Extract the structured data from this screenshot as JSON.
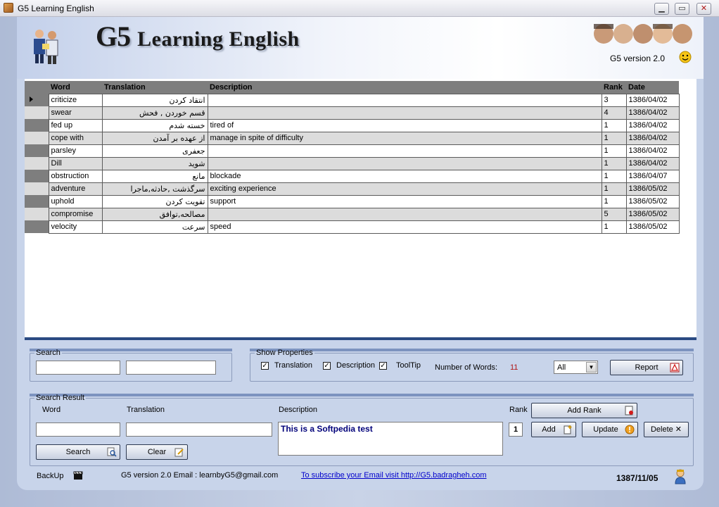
{
  "window": {
    "title": "G5 Learning English",
    "min": "▁",
    "max": "▭",
    "close": "✕"
  },
  "header": {
    "title_main": "G5",
    "title_rest": "Learning English",
    "version": "G5 version 2.0"
  },
  "grid": {
    "columns": [
      "Word",
      "Translation",
      "Description",
      "Rank",
      "Date"
    ],
    "rows": [
      {
        "word": "criticize",
        "translation": "انتقاد کردن",
        "description": "",
        "rank": "3",
        "date": "1386/04/02"
      },
      {
        "word": "swear",
        "translation": "قسم خوردن , فحش",
        "description": "",
        "rank": "4",
        "date": "1386/04/02"
      },
      {
        "word": "fed up",
        "translation": "خسته شدم",
        "description": "tired of",
        "rank": "1",
        "date": "1386/04/02"
      },
      {
        "word": "cope with",
        "translation": "از عهده بر آمدن",
        "description": "manage in spite of difficulty",
        "rank": "1",
        "date": "1386/04/02"
      },
      {
        "word": "parsley",
        "translation": "جعفری",
        "description": "",
        "rank": "1",
        "date": "1386/04/02"
      },
      {
        "word": "Dill",
        "translation": "شوید",
        "description": "",
        "rank": "1",
        "date": "1386/04/02"
      },
      {
        "word": "obstruction",
        "translation": "مانع",
        "description": "blockade",
        "rank": "1",
        "date": "1386/04/07"
      },
      {
        "word": "adventure",
        "translation": "سرگذشت ,حادثه,ماجرا",
        "description": "exciting experience",
        "rank": "1",
        "date": "1386/05/02"
      },
      {
        "word": "uphold",
        "translation": "تقویت کردن",
        "description": "support",
        "rank": "1",
        "date": "1386/05/02"
      },
      {
        "word": "compromise",
        "translation": "مصالحه,توافق",
        "description": "",
        "rank": "5",
        "date": "1386/05/02"
      },
      {
        "word": "velocity",
        "translation": "سرعت",
        "description": "speed",
        "rank": "1",
        "date": "1386/05/02"
      }
    ]
  },
  "search": {
    "legend": "Search",
    "word_value": "",
    "translation_value": ""
  },
  "show_properties": {
    "legend": "Show Properties",
    "translation_label": "Translation",
    "description_label": "Description",
    "tooltip_label": "ToolTip",
    "check_mark": "✓",
    "words_label": "Number  of  Words:",
    "words_count": "11",
    "filter_value": "All",
    "report_label": "Report"
  },
  "search_result": {
    "legend": "Search Result",
    "word_label": "Word",
    "translation_label": "Translation",
    "description_label": "Description",
    "rank_label": "Rank",
    "word_value": "",
    "translation_value": "",
    "description_value": "This is a Softpedia test",
    "rank_value": "1",
    "add_rank_label": "Add Rank",
    "add_label": "Add",
    "update_label": "Update",
    "delete_label": "Delete ✕",
    "search_label": "Search",
    "clear_label": "Clear"
  },
  "footer": {
    "backup_label": "BackUp",
    "email_text": "G5 version 2.0 Email : learnbyG5@gmail.com",
    "subscribe_text": "To subscribe your Email visit http://G5.badragheh.com",
    "date": "1387/11/05"
  }
}
